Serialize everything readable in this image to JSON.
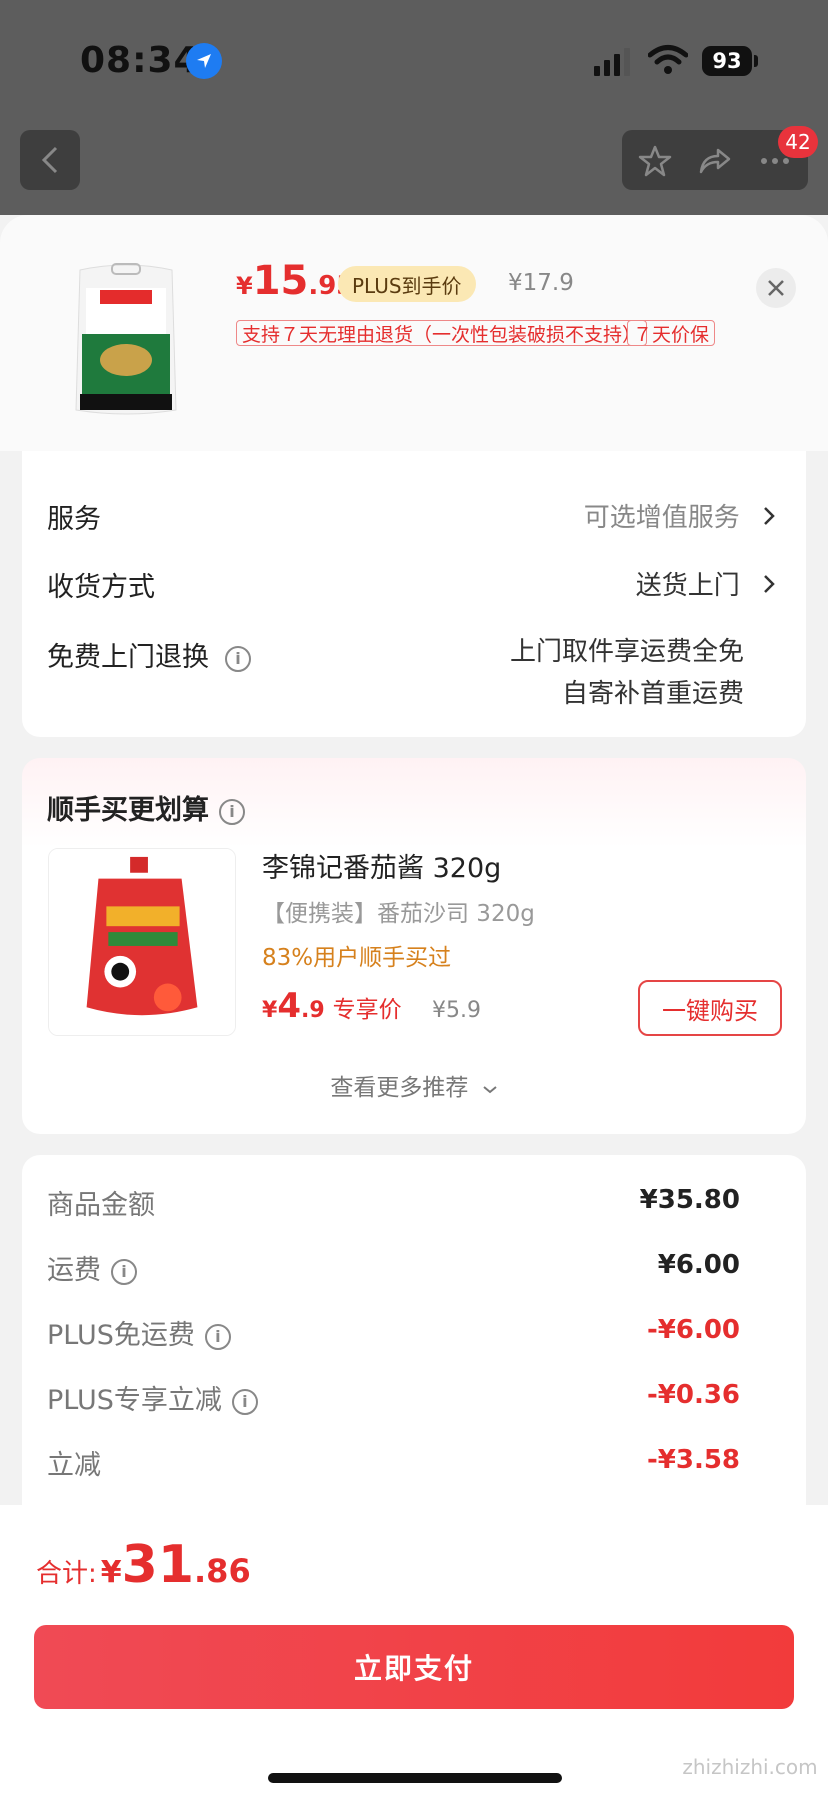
{
  "status_bar": {
    "time": "08:34",
    "battery": "93"
  },
  "nav": {
    "cart_badge": "42"
  },
  "product": {
    "price_currency": "¥",
    "price_int": "15",
    "price_dec": ".93",
    "plus_tag": "PLUS到手价",
    "original_price": "¥17.9",
    "tags": [
      "支持７天无理由退货（一次性包装破损不支持）",
      "７天价保"
    ]
  },
  "service": {
    "rows": [
      {
        "label": "服务",
        "value": "可选增值服务"
      },
      {
        "label": "收货方式",
        "value": "送货上门"
      },
      {
        "label": "免费上门退换",
        "value_line1": "上门取件享运费全免",
        "value_line2": "自寄补首重运费"
      }
    ]
  },
  "reco": {
    "title": "顺手买更划算",
    "item": {
      "name": "李锦记番茄酱 320g",
      "spec": "【便携装】番茄沙司 320g",
      "rate": "83%用户顺手买过",
      "price_currency": "¥",
      "price_int": "4",
      "price_dec": ".9",
      "price_label": "专享价",
      "original_price": "¥5.9",
      "buy_label": "一键购买"
    },
    "more": "查看更多推荐"
  },
  "cost": {
    "rows": [
      {
        "label": "商品金额",
        "value": "¥35.80"
      },
      {
        "label": "运费",
        "value": "¥6.00"
      },
      {
        "label": "PLUS免运费",
        "value": "-¥6.00"
      },
      {
        "label": "PLUS专享立减",
        "value": "-¥0.36"
      },
      {
        "label": "立减",
        "value": "-¥3.58"
      }
    ]
  },
  "footer": {
    "total_label": "合计:",
    "total_currency": "¥",
    "total_int": "31",
    "total_dec": ".86",
    "pay_label": "立即支付",
    "watermark": "zhizhizhi.com"
  },
  "colors": {
    "accent": "#e52e2e",
    "plus_tag_bg": "#fbe8b4",
    "rate": "#d6811d"
  }
}
